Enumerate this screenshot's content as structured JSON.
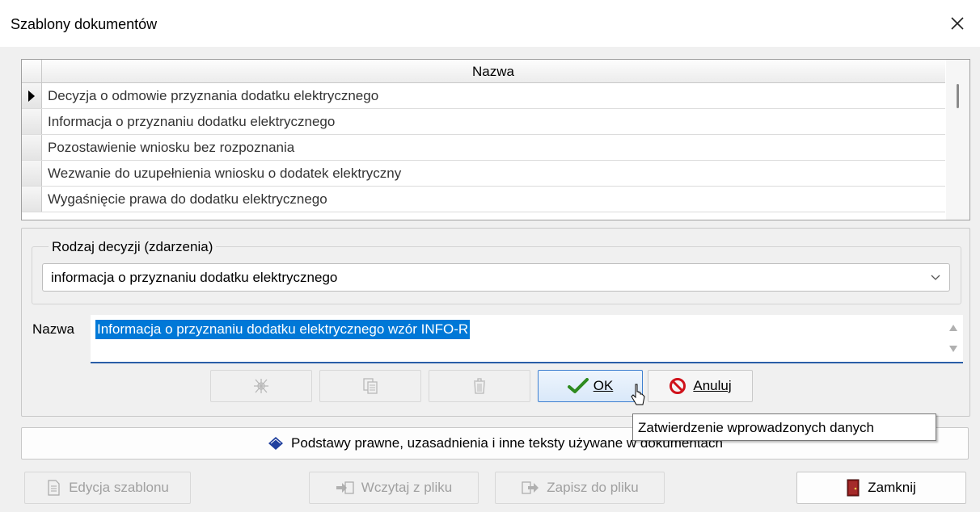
{
  "window": {
    "title": "Szablony dokumentów"
  },
  "grid": {
    "header": "Nazwa",
    "rows": [
      "Decyzja o odmowie przyznania dodatku elektrycznego",
      "Informacja o przyznaniu dodatku elektrycznego",
      "Pozostawienie wniosku bez rozpoznania",
      "Wezwanie do uzupełnienia wniosku o dodatek elektryczny",
      "Wygaśnięcie prawa do dodatku elektrycznego"
    ],
    "current_row_index": 0
  },
  "decision": {
    "legend": "Rodzaj decyzji (zdarzenia)",
    "selected": "informacja o przyznaniu dodatku elektrycznego"
  },
  "name": {
    "label": "Nazwa",
    "value": "Informacja o przyznaniu dodatku elektrycznego wzór INFO-R"
  },
  "edit_buttons": {
    "ok_label": "OK",
    "cancel_label": "Anuluj"
  },
  "tooltip": "Zatwierdzenie wprowadzonych danych",
  "legal_button": "Podstawy prawne, uzasadnienia i inne teksty używane w dokumentach",
  "footer": {
    "edit_template": "Edycja szablonu",
    "load_file": "Wczytaj z pliku",
    "save_file": "Zapisz do pliku",
    "close": "Zamknij"
  },
  "colors": {
    "selection": "#0078d7",
    "ok_border": "#3d7fd0",
    "focus_underline": "#2a5ea8"
  }
}
